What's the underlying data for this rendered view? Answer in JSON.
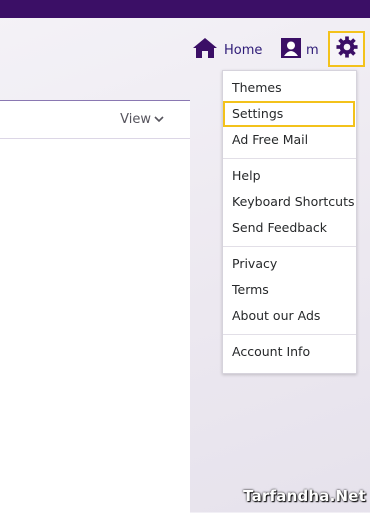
{
  "nav": {
    "home_label": "Home",
    "profile_label": "m"
  },
  "panel": {
    "view_label": "View"
  },
  "menu": {
    "groups": [
      {
        "items": [
          {
            "label": "Themes"
          },
          {
            "label": "Settings",
            "highlighted": true
          },
          {
            "label": "Ad Free Mail"
          }
        ]
      },
      {
        "items": [
          {
            "label": "Help"
          },
          {
            "label": "Keyboard Shortcuts"
          },
          {
            "label": "Send Feedback"
          }
        ]
      },
      {
        "items": [
          {
            "label": "Privacy"
          },
          {
            "label": "Terms"
          },
          {
            "label": "About our Ads"
          }
        ]
      },
      {
        "items": [
          {
            "label": "Account Info"
          }
        ]
      }
    ]
  },
  "icons": {
    "home": "home-icon",
    "profile": "profile-icon",
    "settings": "gear-icon",
    "view_dropdown": "chevron-down-icon"
  },
  "watermark": "Tarfandha.Net",
  "colors": {
    "brand_purple": "#3b0f66",
    "link_purple": "#2e1b77",
    "highlight_yellow": "#f3c21b"
  }
}
